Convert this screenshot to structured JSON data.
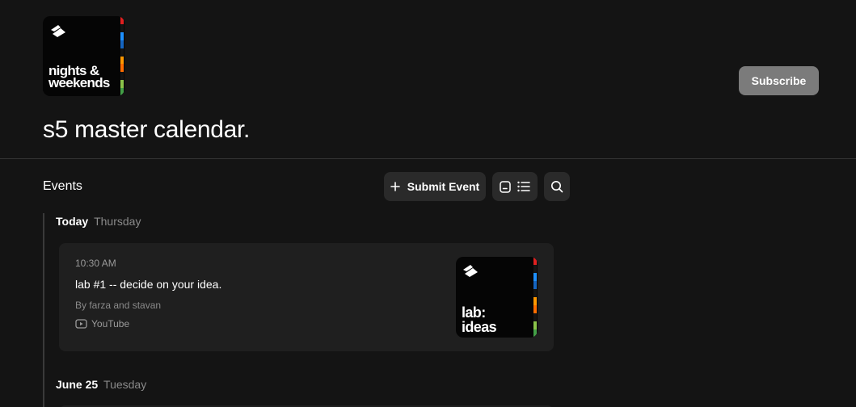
{
  "header": {
    "logo_text": "nights &\nweekends",
    "subscribe_label": "Subscribe",
    "title": "s5 master calendar."
  },
  "events_section": {
    "label": "Events",
    "submit_label": "Submit Event",
    "icons": [
      "plus-icon",
      "calendar-view-icon",
      "list-view-icon",
      "search-icon"
    ]
  },
  "days": [
    {
      "label": "Today",
      "weekday": "Thursday",
      "events": [
        {
          "time": "10:30 AM",
          "title": "lab #1 -- decide on your idea.",
          "host": "By farza and stavan",
          "platform": "YouTube",
          "thumb_text": "lab:\nideas"
        }
      ]
    },
    {
      "label": "June 25",
      "weekday": "Tuesday",
      "events": []
    }
  ],
  "colors": {
    "background": "#141414",
    "card": "#1f1f1f",
    "button": "#2a2a2a",
    "subscribe": "#7b7b7b",
    "stripe": [
      "#e02020",
      "#ff4a1a",
      "#1e90ff",
      "#1565c0",
      "#ff9800",
      "#ff6d00",
      "#8bc34a",
      "#43a047"
    ]
  }
}
